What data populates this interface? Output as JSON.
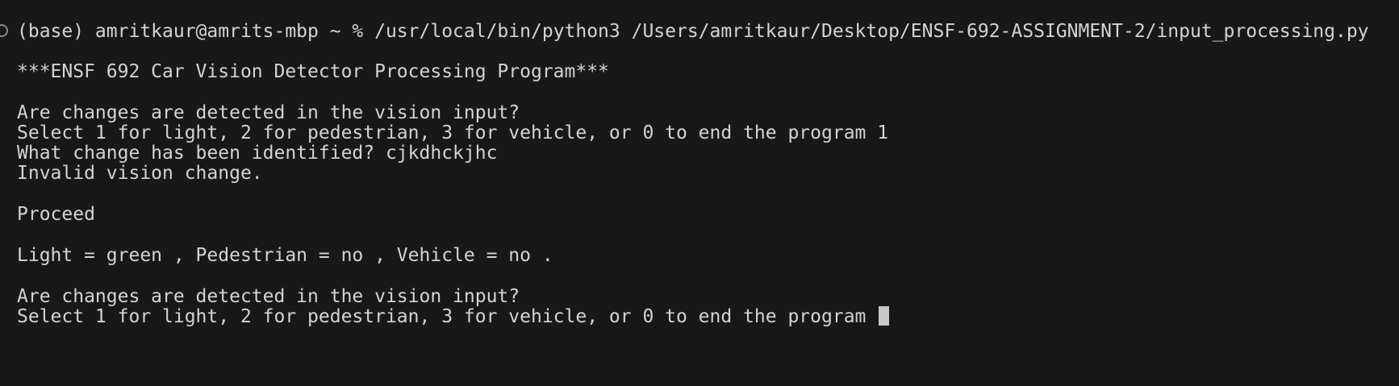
{
  "terminal": {
    "lines": [
      "(base) amritkaur@amrits-mbp ~ % /usr/local/bin/python3 /Users/amritkaur/Desktop/ENSF-692-ASSIGNMENT-2/input_processing.py",
      "***ENSF 692 Car Vision Detector Processing Program***",
      "Are changes are detected in the vision input?",
      "Select 1 for light, 2 for pedestrian, 3 for vehicle, or 0 to end the program 1",
      "What change has been identified? cjkdhckjhc",
      "Invalid vision change.",
      "Proceed",
      "Light = green , Pedestrian = no , Vehicle = no .",
      "Are changes are detected in the vision input?",
      "Select 1 for light, 2 for pedestrian, 3 for vehicle, or 0 to end the program "
    ]
  }
}
